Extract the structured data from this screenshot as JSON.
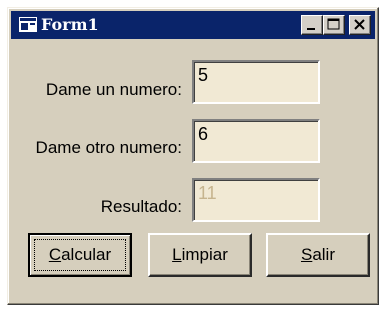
{
  "window": {
    "title": "Form1",
    "controls": {
      "minimize": "minimize",
      "maximize": "maximize",
      "close": "close"
    }
  },
  "form": {
    "numero1": {
      "label": "Dame un numero:",
      "value": "5"
    },
    "numero2": {
      "label": "Dame otro numero:",
      "value": "6"
    },
    "resultado": {
      "label": "Resultado:",
      "value": "11"
    }
  },
  "buttons": {
    "calcular": {
      "hotkey": "C",
      "rest": "alcular"
    },
    "limpiar": {
      "hotkey": "L",
      "rest": "impiar"
    },
    "salir": {
      "hotkey": "S",
      "rest": "alir"
    }
  },
  "icons": [
    "app-icon",
    "minimize-icon",
    "maximize-icon",
    "close-icon"
  ]
}
